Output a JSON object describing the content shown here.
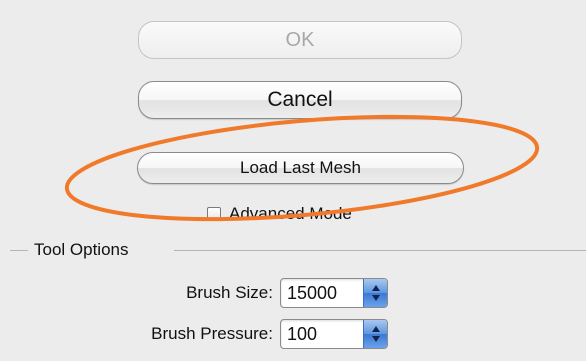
{
  "dialog": {
    "ok_label": "OK",
    "cancel_label": "Cancel",
    "load_last_mesh_label": "Load Last Mesh",
    "advanced_mode": {
      "label": "Advanced Mode",
      "checked": false
    }
  },
  "tool_options": {
    "title": "Tool Options",
    "brush_size": {
      "label": "Brush Size:",
      "value": "15000"
    },
    "brush_pressure": {
      "label": "Brush Pressure:",
      "value": "100"
    }
  },
  "annotation": {
    "color": "#f07a2a"
  },
  "icons": {
    "stepper": "up-down-arrows-icon",
    "checkbox": "checkbox-unchecked-icon"
  }
}
